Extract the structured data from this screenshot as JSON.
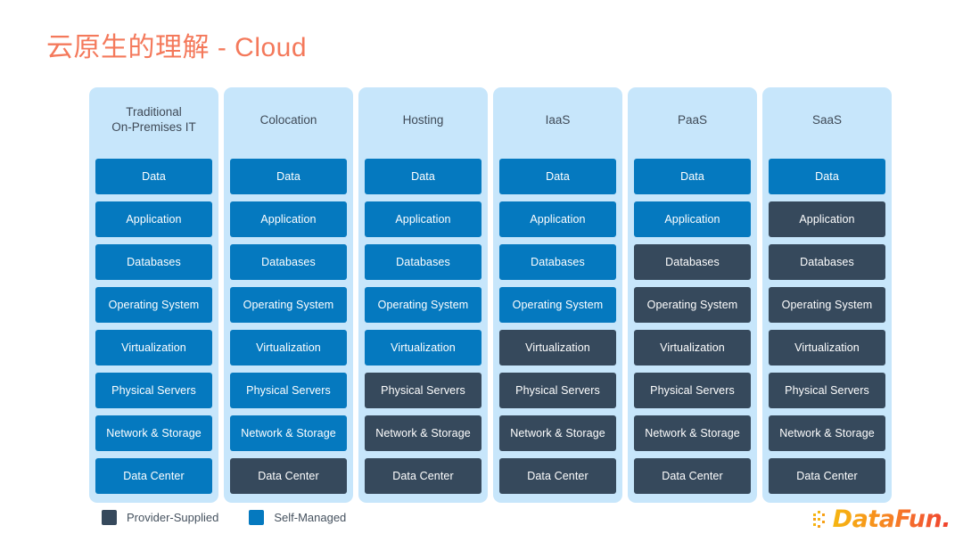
{
  "slide": {
    "title": "云原生的理解 - Cloud",
    "title_color": "#f4795b",
    "background_color": "#ffffff"
  },
  "colors": {
    "self_managed": "#0579bf",
    "provider_supplied": "#36495c",
    "column_background": "#c7e6fb",
    "header_text": "#3f4a57"
  },
  "chart_data": {
    "type": "table",
    "title": "云原生的理解 - Cloud",
    "legend_position": "bottom-left",
    "row_labels": [
      "Data",
      "Application",
      "Databases",
      "Operating System",
      "Virtualization",
      "Physical Servers",
      "Network & Storage",
      "Data Center"
    ],
    "categories": [
      "Traditional\nOn-Premises IT",
      "Colocation",
      "Hosting",
      "IaaS",
      "PaaS",
      "SaaS"
    ],
    "series": [
      {
        "name": "Traditional On-Premises IT",
        "values": [
          "self",
          "self",
          "self",
          "self",
          "self",
          "self",
          "self",
          "self"
        ]
      },
      {
        "name": "Colocation",
        "values": [
          "self",
          "self",
          "self",
          "self",
          "self",
          "self",
          "self",
          "provider"
        ]
      },
      {
        "name": "Hosting",
        "values": [
          "self",
          "self",
          "self",
          "self",
          "self",
          "provider",
          "provider",
          "provider"
        ]
      },
      {
        "name": "IaaS",
        "values": [
          "self",
          "self",
          "self",
          "self",
          "provider",
          "provider",
          "provider",
          "provider"
        ]
      },
      {
        "name": "PaaS",
        "values": [
          "self",
          "self",
          "provider",
          "provider",
          "provider",
          "provider",
          "provider",
          "provider"
        ]
      },
      {
        "name": "SaaS",
        "values": [
          "self",
          "provider",
          "provider",
          "provider",
          "provider",
          "provider",
          "provider",
          "provider"
        ]
      }
    ]
  },
  "matrix": {
    "columns": [
      {
        "header": "Traditional\nOn-Premises IT",
        "tiles": [
          {
            "label": "Data",
            "owner": "self"
          },
          {
            "label": "Application",
            "owner": "self"
          },
          {
            "label": "Databases",
            "owner": "self"
          },
          {
            "label": "Operating System",
            "owner": "self"
          },
          {
            "label": "Virtualization",
            "owner": "self"
          },
          {
            "label": "Physical Servers",
            "owner": "self"
          },
          {
            "label": "Network & Storage",
            "owner": "self"
          },
          {
            "label": "Data Center",
            "owner": "self"
          }
        ]
      },
      {
        "header": "Colocation",
        "tiles": [
          {
            "label": "Data",
            "owner": "self"
          },
          {
            "label": "Application",
            "owner": "self"
          },
          {
            "label": "Databases",
            "owner": "self"
          },
          {
            "label": "Operating System",
            "owner": "self"
          },
          {
            "label": "Virtualization",
            "owner": "self"
          },
          {
            "label": "Physical Servers",
            "owner": "self"
          },
          {
            "label": "Network & Storage",
            "owner": "self"
          },
          {
            "label": "Data Center",
            "owner": "provider"
          }
        ]
      },
      {
        "header": "Hosting",
        "tiles": [
          {
            "label": "Data",
            "owner": "self"
          },
          {
            "label": "Application",
            "owner": "self"
          },
          {
            "label": "Databases",
            "owner": "self"
          },
          {
            "label": "Operating System",
            "owner": "self"
          },
          {
            "label": "Virtualization",
            "owner": "self"
          },
          {
            "label": "Physical Servers",
            "owner": "provider"
          },
          {
            "label": "Network & Storage",
            "owner": "provider"
          },
          {
            "label": "Data Center",
            "owner": "provider"
          }
        ]
      },
      {
        "header": "IaaS",
        "tiles": [
          {
            "label": "Data",
            "owner": "self"
          },
          {
            "label": "Application",
            "owner": "self"
          },
          {
            "label": "Databases",
            "owner": "self"
          },
          {
            "label": "Operating System",
            "owner": "self"
          },
          {
            "label": "Virtualization",
            "owner": "provider"
          },
          {
            "label": "Physical Servers",
            "owner": "provider"
          },
          {
            "label": "Network & Storage",
            "owner": "provider"
          },
          {
            "label": "Data Center",
            "owner": "provider"
          }
        ]
      },
      {
        "header": "PaaS",
        "tiles": [
          {
            "label": "Data",
            "owner": "self"
          },
          {
            "label": "Application",
            "owner": "self"
          },
          {
            "label": "Databases",
            "owner": "provider"
          },
          {
            "label": "Operating System",
            "owner": "provider"
          },
          {
            "label": "Virtualization",
            "owner": "provider"
          },
          {
            "label": "Physical Servers",
            "owner": "provider"
          },
          {
            "label": "Network & Storage",
            "owner": "provider"
          },
          {
            "label": "Data Center",
            "owner": "provider"
          }
        ]
      },
      {
        "header": "SaaS",
        "tiles": [
          {
            "label": "Data",
            "owner": "self"
          },
          {
            "label": "Application",
            "owner": "provider"
          },
          {
            "label": "Databases",
            "owner": "provider"
          },
          {
            "label": "Operating System",
            "owner": "provider"
          },
          {
            "label": "Virtualization",
            "owner": "provider"
          },
          {
            "label": "Physical Servers",
            "owner": "provider"
          },
          {
            "label": "Network & Storage",
            "owner": "provider"
          },
          {
            "label": "Data Center",
            "owner": "provider"
          }
        ]
      }
    ]
  },
  "legend": {
    "items": [
      {
        "label": "Provider-Supplied",
        "owner": "provider"
      },
      {
        "label": "Self-Managed",
        "owner": "self"
      }
    ]
  },
  "logo": {
    "text": "DataFun.",
    "icon": "dot-grid-icon"
  }
}
